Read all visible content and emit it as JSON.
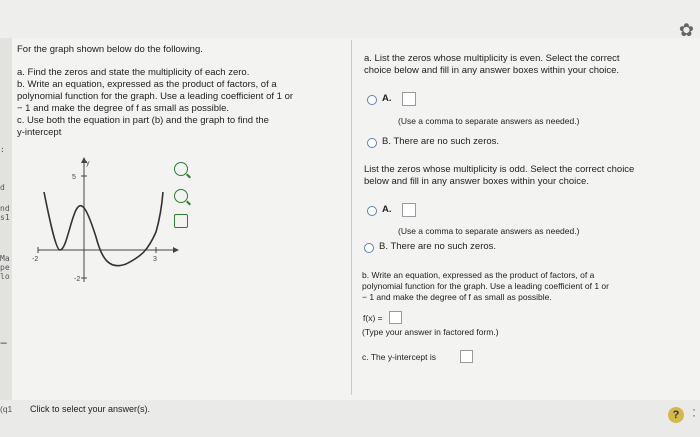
{
  "left": {
    "intro": "For the graph shown below do the following.",
    "a_line": "a. Find the zeros and state the multiplicity of each zero.",
    "b_line1": "b. Write an equation, expressed as the product of factors, of a",
    "b_line2": "polynomial function for the graph. Use a leading coefficient of 1 or",
    "b_line3": "− 1 and make the degree of f as small as possible.",
    "c_line1": "c. Use both the equation in part (b) and the graph to find the",
    "c_line2": "y-intercept"
  },
  "graph": {
    "y_label": "y",
    "y_top_tick": "5",
    "y_bottom_tick": "-2",
    "x_left_tick": "-2",
    "x_right_tick": "3"
  },
  "right": {
    "part_a_prompt1": "a. List the zeros whose multiplicity is even. Select the correct",
    "part_a_prompt2": "choice below and fill in any answer boxes within your choice.",
    "even_option_a": "A.",
    "even_option_a_note": "(Use a comma to separate answers as needed.)",
    "even_option_b": "B.  There are no such zeros.",
    "odd_prompt1": "List the zeros whose multiplicity is odd. Select the correct choice",
    "odd_prompt2": "below and fill in any answer boxes within your choice.",
    "odd_option_a": "A.",
    "odd_option_a_note": "(Use a comma to separate answers as needed.)",
    "odd_option_b": "B.  There are no such zeros.",
    "part_b1": "b. Write an equation, expressed as the product of factors, of a",
    "part_b2": "polynomial function for the graph. Use a leading coefficient of 1 or",
    "part_b3": "− 1 and make the degree of f as small as possible.",
    "fx_label": "f(x) =",
    "fx_note": "(Type your answer in factored form.)",
    "part_c": "c.  The y-intercept is"
  },
  "edge": {
    "chars": [
      ":",
      "d",
      "nd",
      "s1",
      "Ma",
      "pe",
      "lo"
    ],
    "footer_prefix": "(q1",
    "footer_dash": "−"
  },
  "footer": {
    "click_label": "Click to select your answer(s).",
    "help": "?"
  },
  "colors": {
    "radio_border": "#5a7fb6",
    "zoom_icon": "#2e7d32",
    "help_bg": "#d4b94a"
  }
}
